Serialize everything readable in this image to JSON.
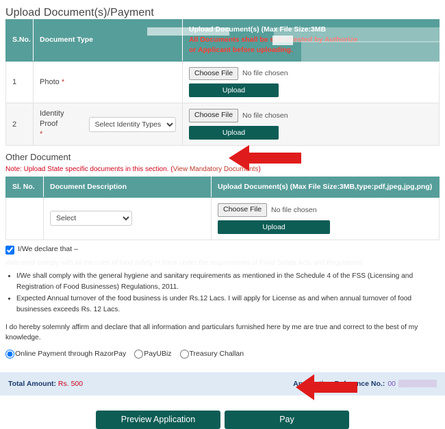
{
  "page": {
    "title": "Upload Document(s)/Payment"
  },
  "doc_table": {
    "headers": {
      "sno": "S.No.",
      "doc_type": "Document Type",
      "upload_line1": "Upload Document(s) (Max File Size:3MB",
      "upload_line2": "All Documents shall be self-attested by Authorize",
      "upload_line3": "or Applicant before uploading."
    },
    "rows": [
      {
        "sno": "1",
        "doc_type": "Photo",
        "required": "*",
        "has_select": false,
        "choose_file": "Choose File",
        "no_file": "No file chosen",
        "upload": "Upload"
      },
      {
        "sno": "2",
        "doc_type": "Identity Proof",
        "required": "*",
        "has_select": true,
        "select_value": "Select Identity Types",
        "choose_file": "Choose File",
        "no_file": "No file chosen",
        "upload": "Upload"
      }
    ]
  },
  "other_document": {
    "section_title": "Other Document",
    "note_prefix": "Note: Upload State specific documents in this section. (",
    "note_link": "View Mandatory Documents",
    "note_suffix": ")",
    "headers": {
      "slno": "Sl. No.",
      "description": "Document Description",
      "upload": "Upload Document(s) (Max File Size:3MB,type:pdf,jpeg,jpg,png)"
    },
    "rows": [
      {
        "slno": "",
        "select_value": "Select",
        "choose_file": "Choose File",
        "no_file": "No file chosen",
        "upload": "Upload"
      }
    ]
  },
  "declaration": {
    "checkbox_label": "I/We declare that –",
    "ghost_line": "I/We shall comply with all the rules of food safety in force under the requirements of Food Safety Acts and Regulations",
    "bullets": [
      "I/We shall comply with the general hygiene and sanitary requirements as mentioned in the Schedule 4 of the FSS (Licensing and Registration of Food Businesses) Regulations, 2011.",
      "Expected Annual turnover of the food business is under Rs.12 Lacs. I will apply for License as and when annual turnover of food businesses exceeds Rs. 12 Lacs."
    ],
    "affirmation": "I do hereby solemnly affirm and declare that all information and particulars furnished here by me are true and correct to the best of my knowledge."
  },
  "payment_options": {
    "selected": "Online Payment through RazorPay",
    "options": [
      "Online Payment through RazorPay",
      "PayUBiz",
      "Treasury Challan"
    ]
  },
  "total_bar": {
    "total_label": "Total Amount:",
    "total_value": "Rs. 500",
    "ref_label": "Application Reference No.:",
    "ref_value": "00"
  },
  "actions": {
    "preview": "Preview Application",
    "pay": "Pay"
  },
  "colors": {
    "table_header": "#569e9a",
    "button_dark_teal": "#0d5d55",
    "note_red": "#d0021b",
    "total_bar_bg": "#dfeaf5",
    "arrow_red": "#e01b1b"
  }
}
